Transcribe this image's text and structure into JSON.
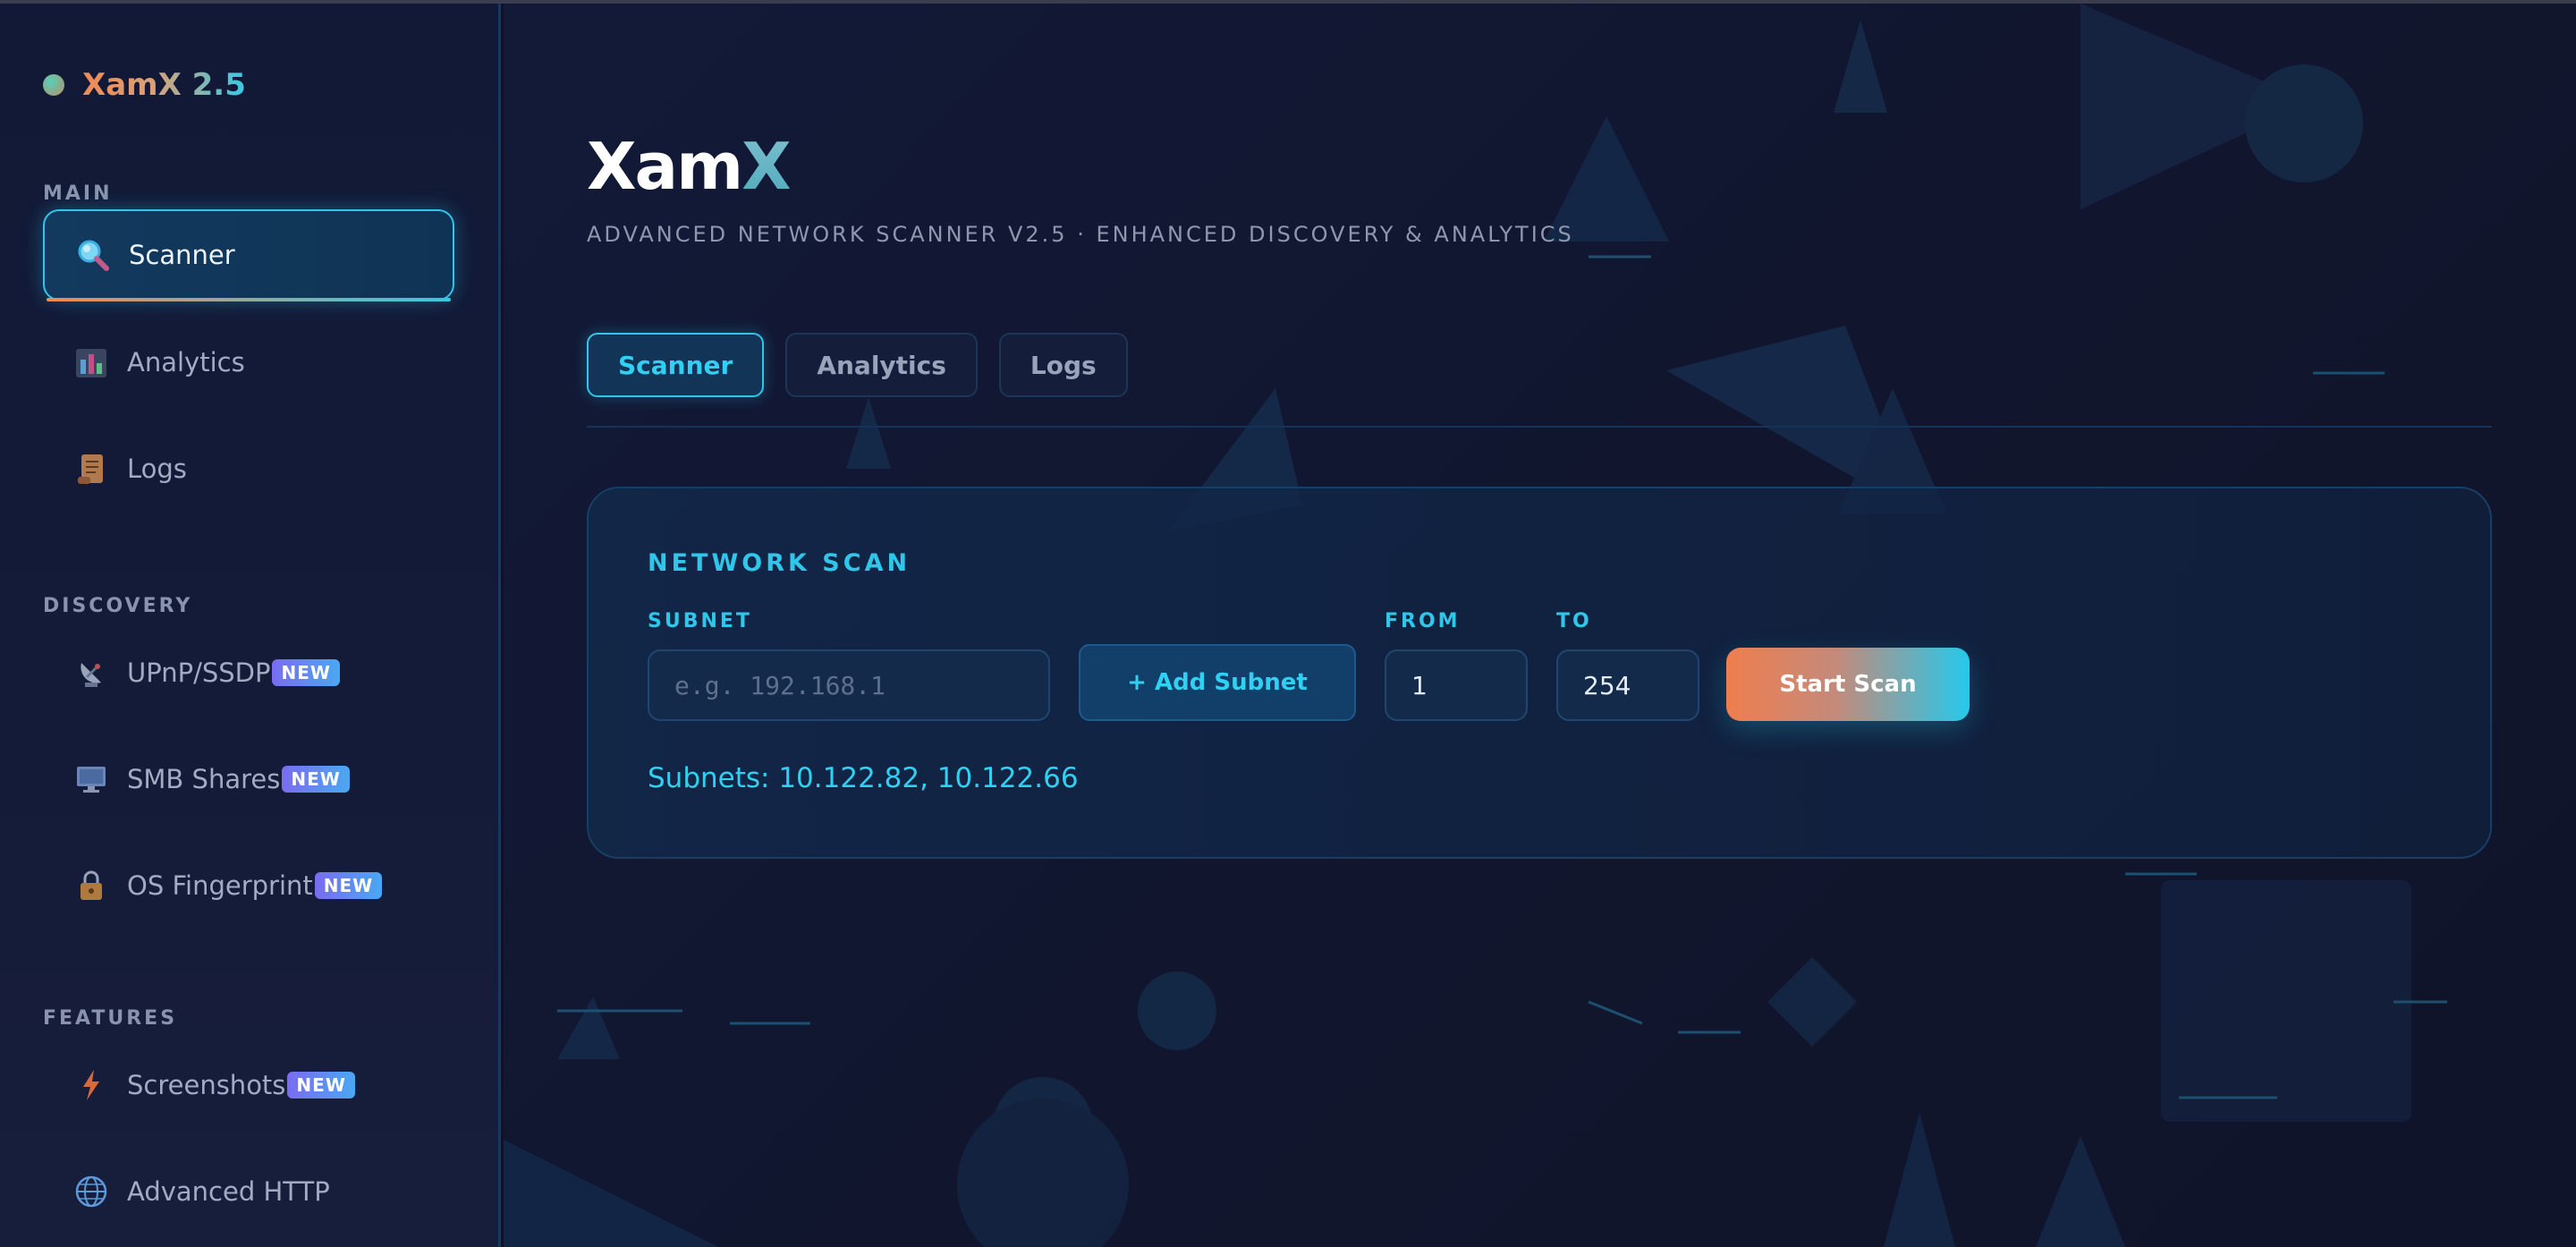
{
  "brand": {
    "title": "XamX 2.5"
  },
  "sidebar": {
    "sections": [
      {
        "label": "MAIN"
      },
      {
        "label": "DISCOVERY"
      },
      {
        "label": "FEATURES"
      }
    ],
    "items": [
      {
        "label": "Scanner",
        "icon": "magnifier-icon",
        "active": true
      },
      {
        "label": "Analytics",
        "icon": "bar-chart-icon"
      },
      {
        "label": "Logs",
        "icon": "scroll-icon"
      },
      {
        "label": "UPnP/SSDP",
        "icon": "satellite-dish-icon",
        "badge": "NEW"
      },
      {
        "label": "SMB Shares",
        "icon": "monitor-icon",
        "badge": "NEW"
      },
      {
        "label": "OS Fingerprint",
        "icon": "lock-icon",
        "badge": "NEW"
      },
      {
        "label": "Screenshots",
        "icon": "lightning-icon",
        "badge": "NEW"
      },
      {
        "label": "Advanced HTTP",
        "icon": "globe-icon"
      }
    ]
  },
  "header": {
    "logo_part1": "Xam",
    "logo_part2": "X",
    "subtitle": "ADVANCED NETWORK SCANNER V2.5 · ENHANCED DISCOVERY & ANALYTICS"
  },
  "tabs": [
    {
      "label": "Scanner",
      "active": true
    },
    {
      "label": "Analytics"
    },
    {
      "label": "Logs"
    }
  ],
  "scan_panel": {
    "title": "NETWORK SCAN",
    "subnet_label": "SUBNET",
    "subnet_placeholder": "e.g. 192.168.1",
    "add_subnet_label": "+ Add Subnet",
    "from_label": "FROM",
    "from_value": "1",
    "to_label": "TO",
    "to_value": "254",
    "start_label": "Start Scan",
    "subnets_text": "Subnets: 10.122.82, 10.122.66"
  },
  "colors": {
    "accent": "#2fc6ea",
    "brand_orange": "#f08a55",
    "badge_start": "#7a6cf0",
    "badge_end": "#4aa8f2"
  }
}
